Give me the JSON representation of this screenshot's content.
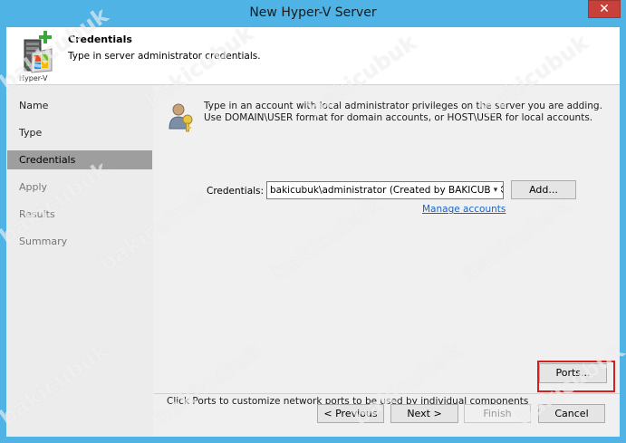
{
  "window": {
    "title": "New Hyper-V Server",
    "close_glyph": "✕"
  },
  "header": {
    "icon_label": "Hyper-V",
    "title": "Credentials",
    "subtitle": "Type in server administrator credentials."
  },
  "sidebar": {
    "items": [
      {
        "label": "Name",
        "state": "visited"
      },
      {
        "label": "Type",
        "state": "visited"
      },
      {
        "label": "Credentials",
        "state": "active"
      },
      {
        "label": "Apply",
        "state": "pending"
      },
      {
        "label": "Results",
        "state": "pending"
      },
      {
        "label": "Summary",
        "state": "pending"
      }
    ]
  },
  "main": {
    "info_line1": "Type in an account with local administrator privileges on the server you are adding.",
    "info_line2": "Use DOMAIN\\USER format for domain accounts, or HOST\\USER for local accounts.",
    "credentials_label": "Credentials:",
    "credentials_value": "bakicubuk\\administrator (Created by BAKICUBUK\\",
    "add_button": "Add...",
    "manage_link": "Manage accounts",
    "ports_text": "Click Ports to customize network ports to be used by individual components",
    "ports_button": "Ports..."
  },
  "footer": {
    "previous": "< Previous",
    "next": "Next >",
    "finish": "Finish",
    "cancel": "Cancel"
  },
  "watermark": {
    "text": "bakicubuk"
  },
  "colors": {
    "frame": "#4fb3e6",
    "close": "#c7403a",
    "active_nav": "#9e9e9e",
    "link": "#1a64c8",
    "highlight": "#d21f1f"
  }
}
